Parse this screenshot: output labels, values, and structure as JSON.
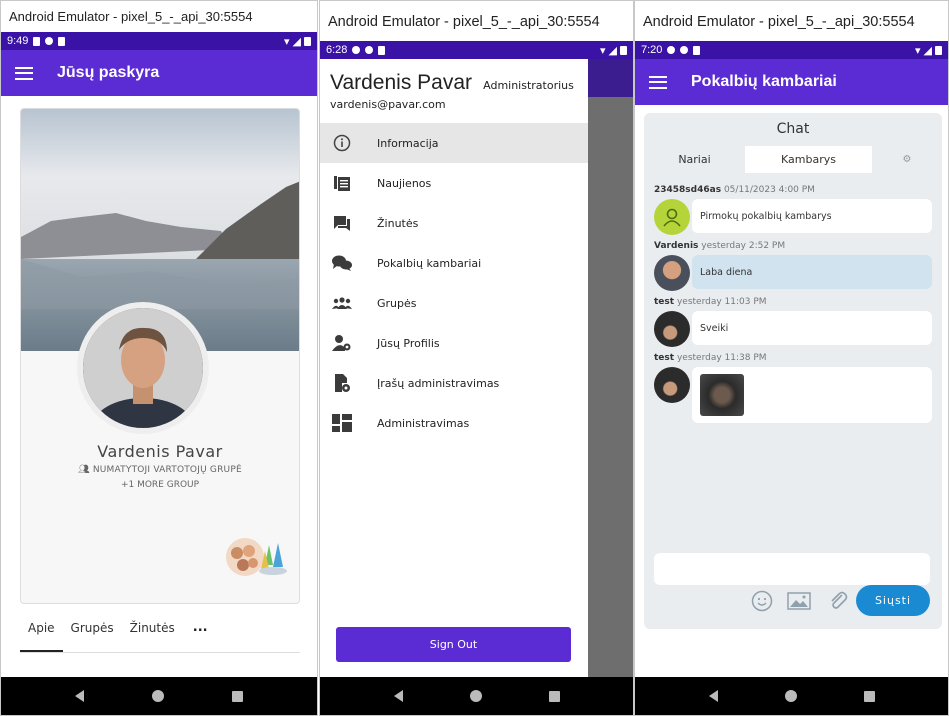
{
  "windows": [
    {
      "title": "Android Emulator - pixel_5_-_api_30:5554",
      "status_time": "9:49",
      "appbar_title": "Jūsų paskyra",
      "profile": {
        "name": "Vardenis Pavar",
        "group": "NUMATYTOJI VARTOTOJŲ GRUPĖ",
        "more_groups": "+1 MORE GROUP"
      },
      "tabs": [
        "Apie",
        "Grupės",
        "Žinutės"
      ],
      "tabs_more": "..."
    },
    {
      "title": "Android Emulator - pixel_5_-_api_30:5554",
      "status_time": "6:28",
      "user": {
        "name": "Vardenis Pavar",
        "role": "Administratorius",
        "email": "vardenis@pavar.com"
      },
      "menu": [
        {
          "label": "Informacija",
          "icon": "info-icon"
        },
        {
          "label": "Naujienos",
          "icon": "news-icon"
        },
        {
          "label": "Žinutės",
          "icon": "message-icon"
        },
        {
          "label": "Pokalbių kambariai",
          "icon": "chat-rooms-icon"
        },
        {
          "label": "Grupės",
          "icon": "groups-icon"
        },
        {
          "label": "Jūsų Profilis",
          "icon": "profile-settings-icon"
        },
        {
          "label": "Įrašų administravimas",
          "icon": "posts-admin-icon"
        },
        {
          "label": "Administravimas",
          "icon": "dashboard-icon"
        }
      ],
      "sign_out": "Sign Out"
    },
    {
      "title": "Android Emulator - pixel_5_-_api_30:5554",
      "status_time": "7:20",
      "appbar_title": "Pokalbių kambariai",
      "chat": {
        "title": "Chat",
        "tabs": [
          "Nariai",
          "Kambarys"
        ],
        "messages": [
          {
            "author": "23458sd46as",
            "time": "05/11/2023 4:00 PM",
            "text": "Pirmokų pokalbių kambarys"
          },
          {
            "author": "Vardenis",
            "time": "yesterday 2:52 PM",
            "text": "Laba diena"
          },
          {
            "author": "test",
            "time": "yesterday 11:03 PM",
            "text": "Sveiki"
          },
          {
            "author": "test",
            "time": "yesterday 11:38 PM",
            "text": ""
          }
        ],
        "compose_placeholder": "",
        "send_label": "Siųsti"
      }
    }
  ],
  "colors": {
    "app_bar": "#5b2bd3",
    "status_bar": "#3a13a6",
    "send_button": "#1a8bd3",
    "highlight_bubble": "#d0e3ef"
  }
}
